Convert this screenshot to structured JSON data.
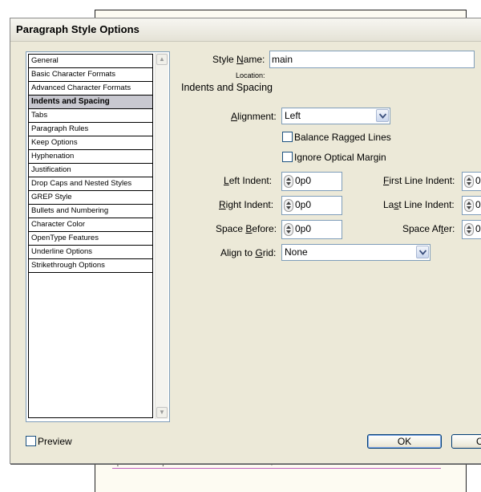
{
  "window": {
    "title": "Paragraph Style Options"
  },
  "background": {
    "strip_text_1": "p 7630 Lee Oaks peninsul canales.",
    "strip_text_2": "fer. Geos vehicle, dust in a. Ell Mirl"
  },
  "sidebar": {
    "items": [
      {
        "label": "General",
        "selected": false
      },
      {
        "label": "Basic Character Formats",
        "selected": false
      },
      {
        "label": "Advanced Character Formats",
        "selected": false
      },
      {
        "label": "Indents and Spacing",
        "selected": true
      },
      {
        "label": "Tabs",
        "selected": false
      },
      {
        "label": "Paragraph Rules",
        "selected": false
      },
      {
        "label": "Keep Options",
        "selected": false
      },
      {
        "label": "Hyphenation",
        "selected": false
      },
      {
        "label": "Justification",
        "selected": false
      },
      {
        "label": "Drop Caps and Nested Styles",
        "selected": false
      },
      {
        "label": "GREP Style",
        "selected": false
      },
      {
        "label": "Bullets and Numbering",
        "selected": false
      },
      {
        "label": "Character Color",
        "selected": false
      },
      {
        "label": "OpenType Features",
        "selected": false
      },
      {
        "label": "Underline Options",
        "selected": false
      },
      {
        "label": "Strikethrough Options",
        "selected": false
      }
    ]
  },
  "main": {
    "style_name_label_pre": "Style ",
    "style_name_label_u": "N",
    "style_name_label_post": "ame:",
    "style_name_value": "main",
    "location_label": "Location:",
    "section_title": "Indents and Spacing",
    "alignment_label_u": "A",
    "alignment_label_post": "lignment:",
    "alignment_value": "Left",
    "balance_ragged_label": "Balance Ragged Lines",
    "ignore_optical_label": "Ignore Optical Margin",
    "left_indent_label_u": "L",
    "left_indent_label_post": "eft Indent:",
    "left_indent_value": "0p0",
    "first_line_indent_label_u": "F",
    "first_line_indent_label_post": "irst Line Indent:",
    "first_line_indent_value": "0",
    "right_indent_label_u": "R",
    "right_indent_label_post": "ight Indent:",
    "right_indent_value": "0p0",
    "last_line_indent_label_pre": "La",
    "last_line_indent_label_u": "s",
    "last_line_indent_label_post": "t Line Indent:",
    "last_line_indent_value": "0",
    "space_before_label_pre": "Space ",
    "space_before_label_u": "B",
    "space_before_label_post": "efore:",
    "space_before_value": "0p0",
    "space_after_label_pre": "Space Af",
    "space_after_label_u": "t",
    "space_after_label_post": "er:",
    "space_after_value": "0",
    "align_grid_label_pre": "Align to ",
    "align_grid_label_u": "G",
    "align_grid_label_post": "rid:",
    "align_grid_value": "None"
  },
  "footer": {
    "preview_label": "Preview",
    "ok_label": "OK",
    "cancel_label": "Ca"
  }
}
